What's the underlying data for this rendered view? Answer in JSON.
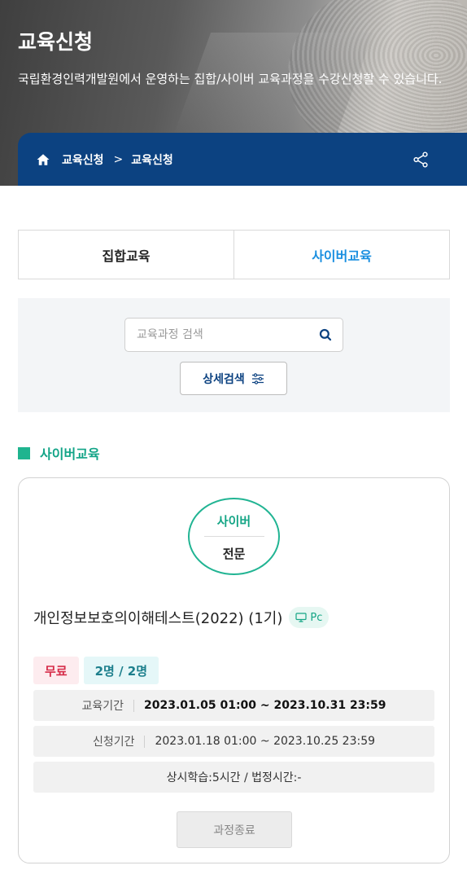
{
  "hero": {
    "title": "교육신청",
    "description": "국립환경인력개발원에서 운영하는 집합/사이버 교육과정을 수강신청할 수 있습니다."
  },
  "breadcrumb": {
    "items": [
      "교육신청",
      "교육신청"
    ],
    "separator": ">",
    "home_icon": "home-icon",
    "share_icon": "share-icon"
  },
  "tabs": [
    {
      "label": "집합교육",
      "active": false
    },
    {
      "label": "사이버교육",
      "active": true
    }
  ],
  "search": {
    "placeholder": "교육과정 검색",
    "value": "",
    "advanced_label": "상세검색"
  },
  "section": {
    "title": "사이버교육"
  },
  "course": {
    "badge_top": "사이버",
    "badge_bottom": "전문",
    "title": "개인정보보호의이해테스트(2022) (1기)",
    "platform": "Pc",
    "fee": "무료",
    "seats": "2명 / 2명",
    "edu_period_label": "교육기간",
    "edu_period": "2023.01.05 01:00 ~ 2023.10.31 23:59",
    "apply_period_label": "신청기간",
    "apply_period": "2023.01.18 01:00 ~ 2023.10.25 23:59",
    "hours": "상시학습:5시간 / 법정시간:-",
    "status_button": "과정종료"
  },
  "colors": {
    "nav_blue": "#0c4281",
    "active_tab": "#1a8fe0",
    "accent_green": "#1fb48f",
    "free_red": "#d62d4a"
  }
}
